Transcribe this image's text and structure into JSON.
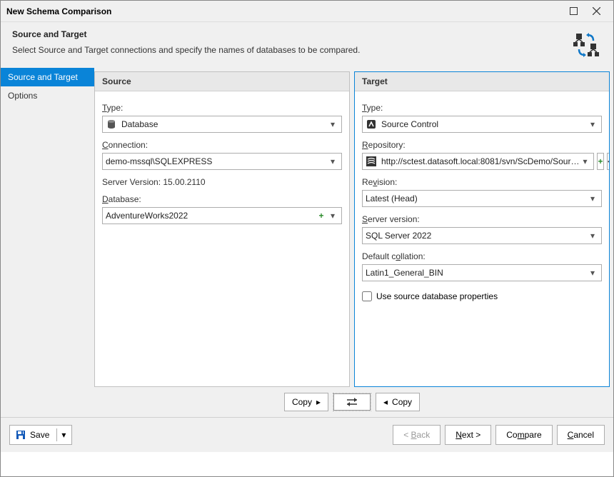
{
  "window": {
    "title": "New Schema Comparison"
  },
  "header": {
    "title": "Source and Target",
    "description": "Select Source and Target connections and specify the names of databases to be compared."
  },
  "sidebar": {
    "items": [
      {
        "label": "Source and Target",
        "active": true
      },
      {
        "label": "Options",
        "active": false
      }
    ]
  },
  "source": {
    "panel_title": "Source",
    "type_label": "Type:",
    "type_value": "Database",
    "connection_label": "Connection:",
    "connection_value": "demo-mssql\\SQLEXPRESS",
    "server_version_text": "Server Version: 15.00.2110",
    "database_label": "Database:",
    "database_value": "AdventureWorks2022"
  },
  "target": {
    "panel_title": "Target",
    "type_label": "Type:",
    "type_value": "Source Control",
    "repository_label": "Repository:",
    "repository_value": "http://sctest.datasoft.local:8081/svn/ScDemo/Sour…",
    "revision_label": "Revision:",
    "revision_value": "Latest (Head)",
    "server_version_label": "Server version:",
    "server_version_value": "SQL Server 2022",
    "collation_label": "Default collation:",
    "collation_value": "Latin1_General_BIN",
    "use_source_label": "Use source database properties"
  },
  "copybar": {
    "copy_left": "Copy",
    "copy_right": "Copy"
  },
  "footer": {
    "save": "Save",
    "back": "< Back",
    "next": "Next >",
    "compare": "Compare",
    "cancel": "Cancel"
  }
}
